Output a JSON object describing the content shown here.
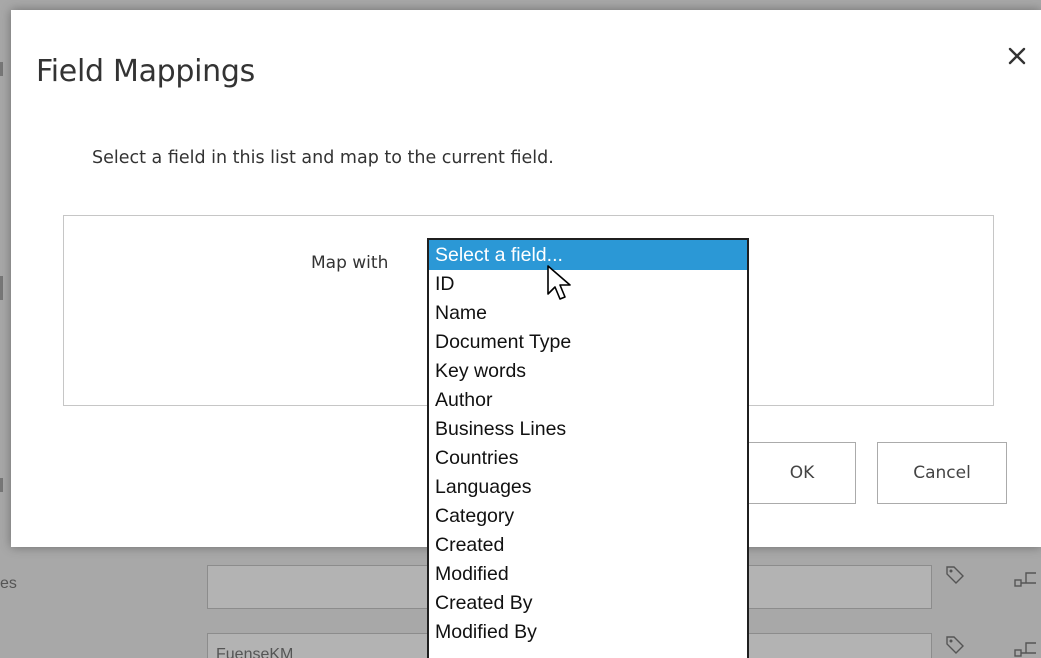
{
  "background": {
    "row_label": "es",
    "second_input_value": "FuenseKM"
  },
  "dialog": {
    "title": "Field Mappings",
    "description": "Select a field in this list and map to the current field.",
    "map_label": "Map with",
    "ok_label": "OK",
    "cancel_label": "Cancel"
  },
  "select": {
    "options": [
      "Select a field...",
      "ID",
      "Name",
      "Document Type",
      "Key words",
      "Author",
      "Business Lines",
      "Countries",
      "Languages",
      "Category",
      "Created",
      "Modified",
      "Created By",
      "Modified By"
    ],
    "selected_index": 0
  },
  "colors": {
    "highlight": "#2b98d6",
    "overlay": "#a8a8a8"
  }
}
